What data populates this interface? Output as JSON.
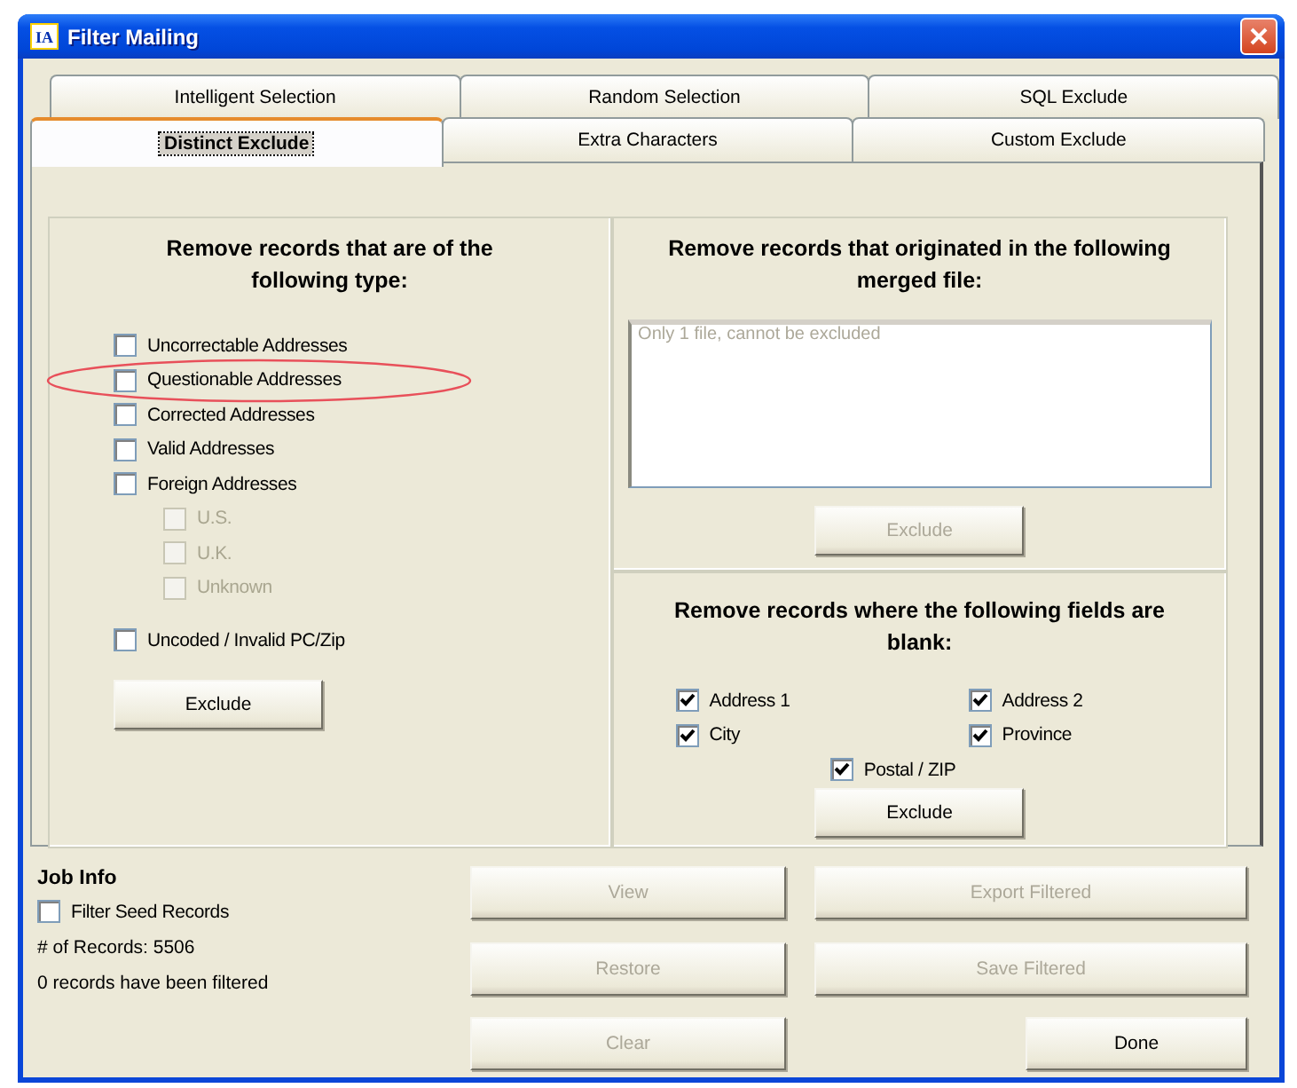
{
  "window": {
    "app_icon_text": "IA",
    "title": "Filter Mailing"
  },
  "tabs": [
    [
      {
        "label": "Intelligent Selection",
        "selected": false
      },
      {
        "label": "Random Selection",
        "selected": false
      },
      {
        "label": "SQL Exclude",
        "selected": false
      }
    ],
    [
      {
        "label": "Distinct Exclude",
        "selected": true
      },
      {
        "label": "Extra Characters",
        "selected": false
      },
      {
        "label": "Custom Exclude",
        "selected": false
      }
    ]
  ],
  "record_types": {
    "title": "Remove records that are of the following type:",
    "checkboxes": [
      {
        "label": "Uncorrectable Addresses",
        "checked": false,
        "disabled": false
      },
      {
        "label": "Questionable Addresses",
        "checked": false,
        "disabled": false,
        "annotation": {
          "kind": "ellipse"
        }
      },
      {
        "label": "Corrected Addresses",
        "checked": false,
        "disabled": false
      },
      {
        "label": "Valid Addresses",
        "checked": false,
        "disabled": false
      },
      {
        "label": "Foreign Addresses",
        "checked": false,
        "disabled": false,
        "children": [
          {
            "label": "U.S.",
            "checked": false,
            "disabled": true
          },
          {
            "label": "U.K.",
            "checked": false,
            "disabled": true
          },
          {
            "label": "Unknown",
            "checked": false,
            "disabled": true
          }
        ]
      },
      {
        "label": "Uncoded / Invalid PC/Zip",
        "checked": false,
        "disabled": false
      }
    ],
    "button": {
      "label": "Exclude",
      "disabled": false
    }
  },
  "merged_file": {
    "title": "Remove records that originated in the following merged file:",
    "list_items": [
      {
        "label": "Only 1 file, cannot be excluded",
        "disabled": true
      }
    ],
    "button": {
      "label": "Exclude",
      "disabled": true
    }
  },
  "blank_fields": {
    "title": "Remove records where the following fields are blank:",
    "checkboxes": [
      {
        "label": "Address 1",
        "checked": true,
        "disabled": false
      },
      {
        "label": "Address 2",
        "checked": true,
        "disabled": false
      },
      {
        "label": "City",
        "checked": true,
        "disabled": false
      },
      {
        "label": "Province",
        "checked": true,
        "disabled": false
      },
      {
        "label": "Postal / ZIP",
        "checked": true,
        "disabled": false
      }
    ],
    "button": {
      "label": "Exclude",
      "disabled": false
    }
  },
  "job_info": {
    "title": "Job Info",
    "checkbox": {
      "label": "Filter Seed Records",
      "checked": false,
      "disabled": false
    },
    "record_count": "# of Records: 5506",
    "filtered_status": "0 records have been filtered"
  },
  "buttons": [
    {
      "label": "View",
      "disabled": true,
      "wide": false
    },
    {
      "label": "Export Filtered",
      "disabled": true,
      "wide": true
    },
    {
      "label": "Restore",
      "disabled": true,
      "wide": false
    },
    {
      "label": "Save Filtered",
      "disabled": true,
      "wide": true
    },
    {
      "label": "Clear",
      "disabled": true,
      "wide": false
    },
    {
      "label": "Done",
      "disabled": false,
      "wide": false
    }
  ]
}
